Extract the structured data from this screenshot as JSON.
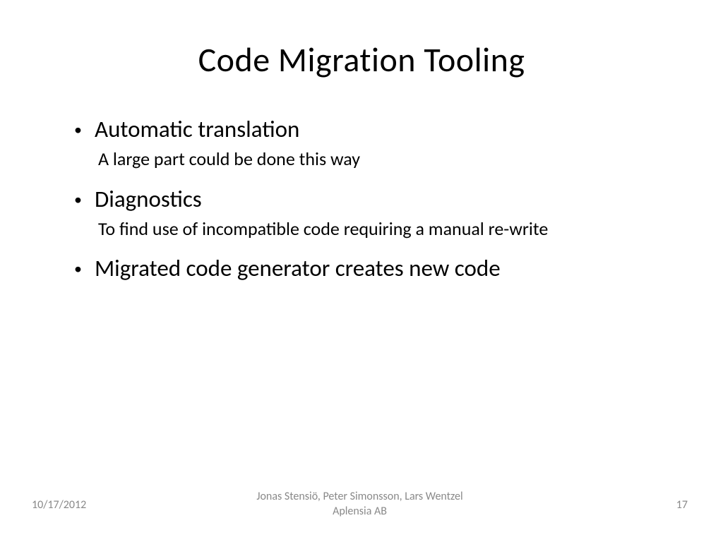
{
  "title": "Code Migration Tooling",
  "bullets": [
    {
      "main": "Automatic translation",
      "sub": "A large part could be done this way"
    },
    {
      "main": "Diagnostics",
      "sub": "To find use of incompatible code requiring a manual re-write"
    },
    {
      "main": "Migrated code generator creates new code",
      "sub": ""
    }
  ],
  "footer": {
    "date": "10/17/2012",
    "authors": "Jonas Stensiö, Peter Simonsson, Lars Wentzel  Aplensia AB",
    "page": "17"
  }
}
